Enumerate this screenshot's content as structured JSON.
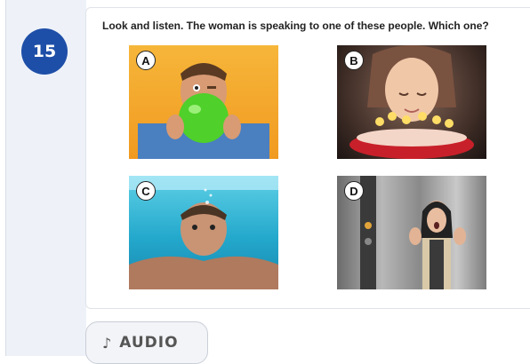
{
  "question_number": "15",
  "question_text": "Look and listen. The woman is speaking to one of these people. Which one?",
  "options": [
    {
      "letter": "A",
      "picture": "man-blowing-green-balloon"
    },
    {
      "letter": "B",
      "picture": "girl-with-birthday-cake-candles"
    },
    {
      "letter": "C",
      "picture": "man-swimming-underwater"
    },
    {
      "letter": "D",
      "picture": "woman-in-elevator-scared"
    }
  ],
  "audio_button": {
    "icon": "music-note-icon",
    "label": "AUDIO"
  },
  "colors": {
    "badge": "#1e4fa8",
    "accent_green": "#4fd02a"
  }
}
